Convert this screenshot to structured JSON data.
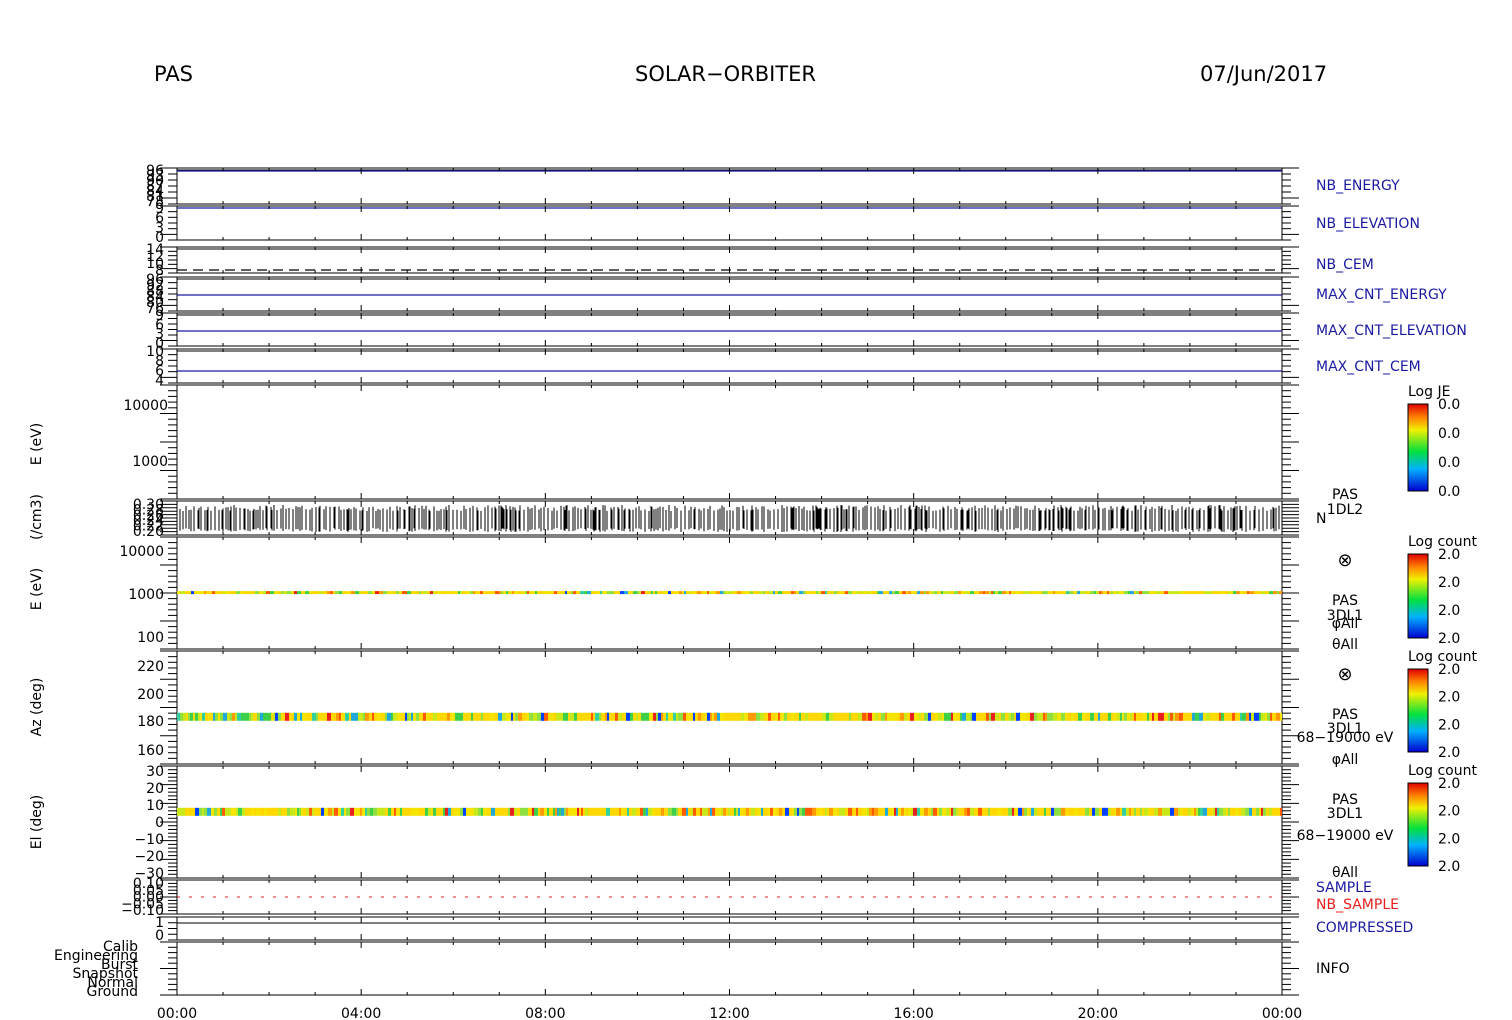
{
  "header": {
    "instrument": "PAS",
    "mission": "SOLAR−ORBITER",
    "date": "07/Jun/2017"
  },
  "colors": {
    "label_blue": "#1a1aa0",
    "label_red": "#e8201e",
    "axis": "#000000"
  },
  "chart_data": {
    "type": "heatmap",
    "x_ticks": [
      "00:00",
      "04:00",
      "08:00",
      "12:00",
      "16:00",
      "20:00",
      "00:00"
    ],
    "x_range_hours": [
      0,
      24
    ],
    "panels": [
      {
        "id": "nb_energy",
        "label": "NB_ENERGY",
        "label_color": "#1a1aa0",
        "ytick_labels": [
          "96",
          "93",
          "90",
          "87",
          "84",
          "81",
          "78"
        ],
        "trace": "constant blue line near top"
      },
      {
        "id": "nb_elevation",
        "label": "NB_ELEVATION",
        "label_color": "#1a1aa0",
        "ytick_labels": [
          "9",
          "6",
          "3",
          "0"
        ],
        "trace": "constant blue line near top"
      },
      {
        "id": "nb_cem",
        "label": "NB_CEM",
        "label_color": "#1a1aa0",
        "ytick_labels": [
          "14",
          "12",
          "10",
          "8"
        ],
        "trace": "constant dashed black line"
      },
      {
        "id": "max_cnt_energy",
        "label": "MAX_CNT_ENERGY",
        "label_color": "#1a1aa0",
        "ytick_labels": [
          "96",
          "92",
          "88",
          "84",
          "80",
          "76"
        ],
        "trace": "constant blue line"
      },
      {
        "id": "max_cnt_elevation",
        "label": "MAX_CNT_ELEVATION",
        "label_color": "#1a1aa0",
        "ytick_labels": [
          "9",
          "6",
          "3",
          "0"
        ],
        "trace": "constant blue line"
      },
      {
        "id": "max_cnt_cem",
        "label": "MAX_CNT_CEM",
        "label_color": "#1a1aa0",
        "ytick_labels": [
          "10",
          "8",
          "6",
          "4"
        ],
        "trace": "constant blue line"
      },
      {
        "id": "pas_1dl2_e",
        "ylabel": "E (eV)",
        "ytick_labels": [
          "10000",
          "1000"
        ],
        "colorbar": {
          "title": "Log JE",
          "ticks": [
            "0.0",
            "0.0",
            "0.0",
            "0.0"
          ]
        }
      },
      {
        "id": "pas_1dl2_n",
        "ylabel": "(/cm3)",
        "ytick_labels": [
          "0.30",
          "0.28",
          "0.26",
          "0.24",
          "0.22",
          "0.20"
        ],
        "side_text": [
          "PAS",
          "1DL2",
          "N"
        ],
        "trace": "dense black spikes"
      },
      {
        "id": "pas_3dl1_e",
        "ylabel": "E (eV)",
        "ytick_labels": [
          "10000",
          "1000",
          "100"
        ],
        "side_text": [
          "⊗",
          "PAS",
          "3DL1",
          "φAll",
          "θAll"
        ],
        "colorbar": {
          "title": "Log count",
          "ticks": [
            "2.0",
            "2.0",
            "2.0",
            "2.0"
          ]
        },
        "band_at": 1050
      },
      {
        "id": "pas_3dl1_az",
        "ylabel": "Az (deg)",
        "ytick_labels": [
          "220",
          "200",
          "180",
          "160"
        ],
        "ylim": [
          148,
          232
        ],
        "side_text": [
          "⊗",
          "PAS",
          "3DL1",
          "68−19000 eV",
          "φAll"
        ],
        "colorbar": {
          "title": "Log count",
          "ticks": [
            "2.0",
            "2.0",
            "2.0",
            "2.0"
          ]
        },
        "band_at": 183
      },
      {
        "id": "pas_3dl1_el",
        "ylabel": "El (deg)",
        "ytick_labels": [
          "30",
          "20",
          "10",
          "0",
          "−10",
          "−20",
          "−30"
        ],
        "ylim": [
          -30,
          30
        ],
        "side_text": [
          "PAS",
          "3DL1",
          "68−19000 eV",
          "θAll"
        ],
        "colorbar": {
          "title": "Log count",
          "ticks": [
            "2.0",
            "2.0",
            "2.0",
            "2.0"
          ]
        },
        "band_at": 6
      },
      {
        "id": "sample",
        "labels": [
          "SAMPLE",
          "NB_SAMPLE"
        ],
        "label_colors": [
          "#1a1aa0",
          "#e8201e"
        ],
        "ytick_labels": [
          "0.10",
          "0.05",
          "0.00",
          "−0.05",
          "−0.10"
        ]
      },
      {
        "id": "compressed",
        "label": "COMPRESSED",
        "label_color": "#1a1aa0",
        "ytick_labels": [
          "1",
          "0"
        ]
      },
      {
        "id": "info",
        "label": "INFO",
        "label_color": "#000000",
        "ytick_labels": [
          "Calib",
          "Engineering",
          "Burst",
          "Snapshot",
          "Normal",
          "Ground"
        ]
      }
    ]
  }
}
